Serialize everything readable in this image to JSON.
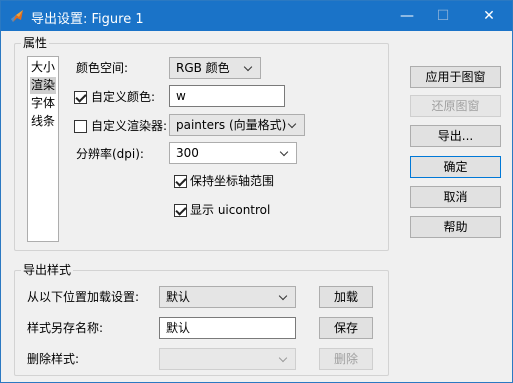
{
  "window": {
    "title": "导出设置: Figure 1",
    "icon": "matlab-icon",
    "controls": {
      "minimize": "—",
      "maximize": "☐",
      "close": "✕"
    }
  },
  "properties_group": {
    "title": "属性",
    "list_items": [
      "大小",
      "渲染",
      "字体",
      "线条"
    ],
    "selected_item": "渲染",
    "colorspace_label": "颜色空间:",
    "colorspace_value": "RGB 颜色",
    "custom_color_label": "自定义颜色:",
    "custom_color_checked": true,
    "custom_color_value": "w",
    "custom_renderer_label": "自定义渲染器:",
    "custom_renderer_checked": false,
    "custom_renderer_value": "painters (向量格式)",
    "resolution_label": "分辨率(dpi):",
    "resolution_value": "300",
    "keep_axes_label": "保持坐标轴范围",
    "keep_axes_checked": true,
    "show_uicontrol_label": "显示 uicontrol",
    "show_uicontrol_checked": true
  },
  "buttons": {
    "apply_to_figure": "应用于图窗",
    "restore_figure": "还原图窗",
    "export": "导出...",
    "ok": "确定",
    "cancel": "取消",
    "help": "帮助"
  },
  "style_group": {
    "title": "导出样式",
    "load_label": "从以下位置加载设置:",
    "load_value": "默认",
    "load_button": "加载",
    "save_label": "样式另存名称:",
    "save_value": "默认",
    "save_button": "保存",
    "delete_label": "删除样式:",
    "delete_value": "",
    "delete_button": "删除"
  }
}
